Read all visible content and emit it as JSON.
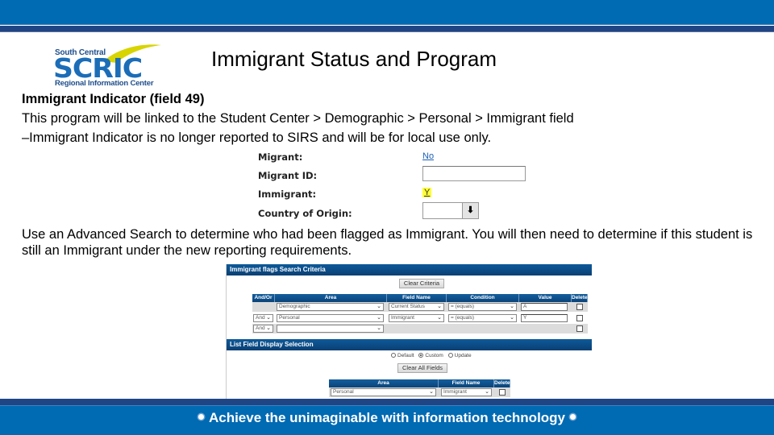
{
  "slide": {
    "title": "Immigrant Status and Program",
    "logo": {
      "top_text": "South Central",
      "acronym": "SCRIC",
      "bottom_text": "Regional Information Center",
      "colors": {
        "blue": "#1b6db8",
        "dark_blue": "#1e4e8c",
        "swoosh": "#d8d400"
      }
    },
    "heading": "Immigrant Indicator (field 49)",
    "line1": "This program will be linked to the Student Center > Demographic > Personal > Immigrant field",
    "line2": "–Immigrant Indicator is no longer reported to SIRS and will be for local use only.",
    "paragraph2": "Use an Advanced Search to determine who had been flagged as Immigrant.  You will then need to determine if this student is still an Immigrant under the new reporting requirements.",
    "footer_tagline": "Achieve the unimaginable with information technology",
    "colors": {
      "banner_blue": "#006ab3",
      "banner_stripe": "#1f4584"
    }
  },
  "migrant_form": {
    "fields": [
      {
        "label": "Migrant:",
        "value": "No",
        "type": "link"
      },
      {
        "label": "Migrant ID:",
        "value": "",
        "type": "text"
      },
      {
        "label": "Immigrant:",
        "value": "Y",
        "type": "highlighted-link"
      },
      {
        "label": "Country of Origin:",
        "value": "",
        "type": "select"
      }
    ]
  },
  "advanced_search": {
    "criteria_title": "Immigrant flags Search Criteria",
    "clear_criteria_label": "Clear Criteria",
    "columns": [
      "And/Or",
      "Area",
      "Field Name",
      "Condition",
      "Value",
      "Delete"
    ],
    "rows": [
      {
        "and_or": "",
        "area": "Demographic",
        "field_name": "Current Status",
        "condition": "= (equals)",
        "value": "A",
        "delete": false
      },
      {
        "and_or": "And",
        "area": "Personal",
        "field_name": "Immigrant",
        "condition": "= (equals)",
        "value": "Y",
        "delete": false
      },
      {
        "and_or": "And",
        "area": "",
        "field_name": "",
        "condition": "",
        "value": "",
        "delete": false
      }
    ],
    "display_title": "List Field Display Selection",
    "display_options": [
      {
        "label": "Default",
        "selected": false
      },
      {
        "label": "Custom",
        "selected": true
      },
      {
        "label": "Update",
        "selected": false
      }
    ],
    "clear_fields_label": "Clear All Fields",
    "display_columns": [
      "Area",
      "Field Name",
      "Delete"
    ],
    "display_rows": [
      {
        "area": "Personal",
        "field_name": "Immigrant",
        "delete": false
      }
    ]
  }
}
